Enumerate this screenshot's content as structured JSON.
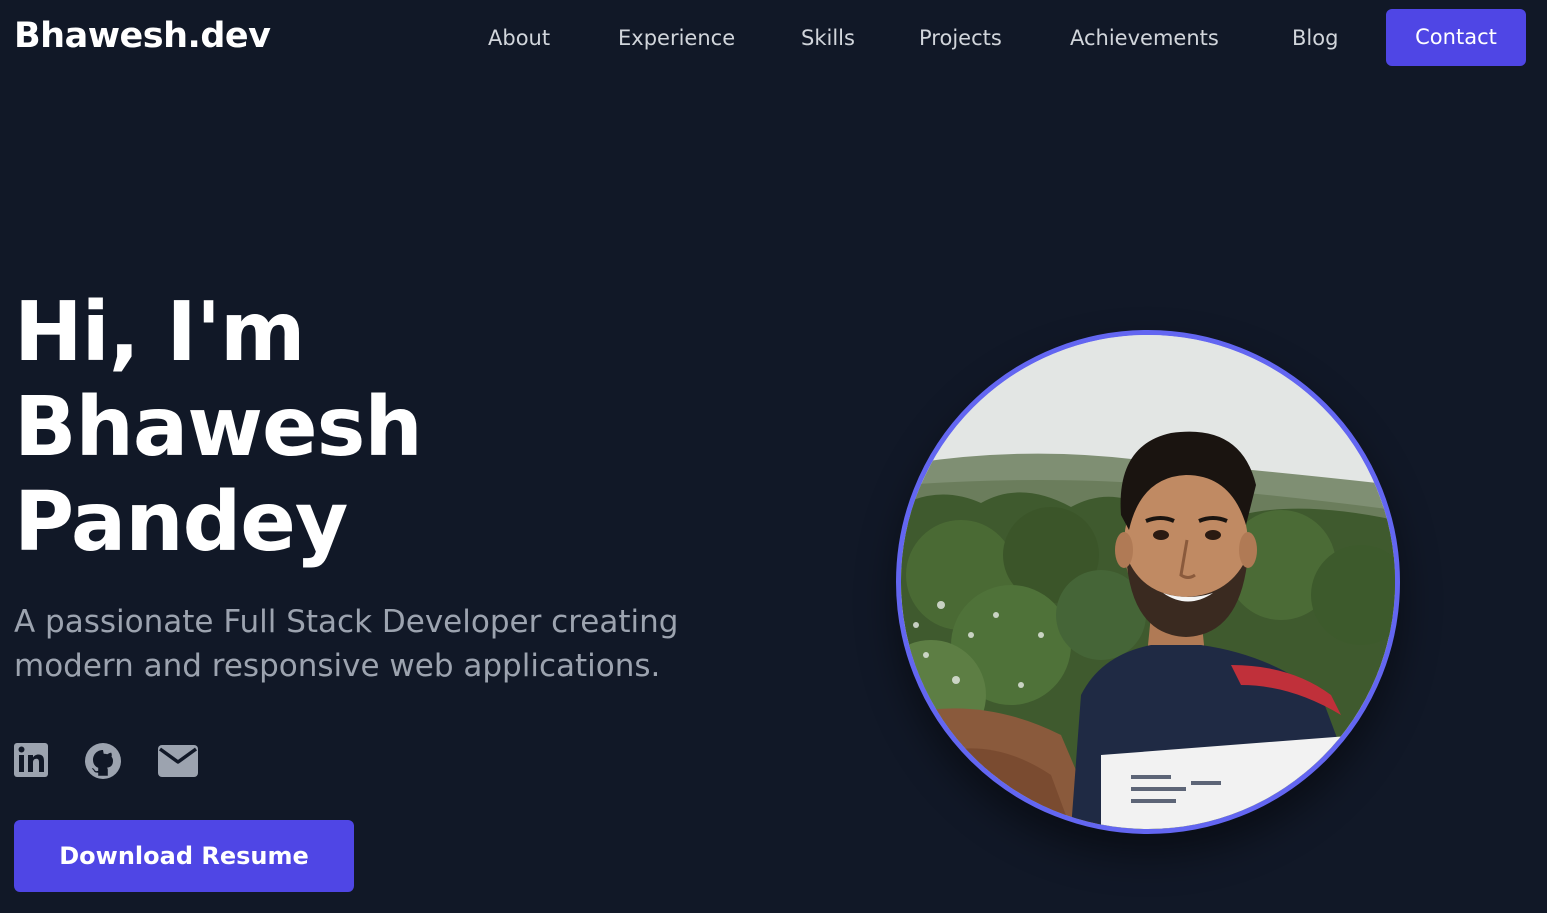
{
  "brand": {
    "logo": "Bhawesh.dev"
  },
  "nav": {
    "items": [
      {
        "label": "About"
      },
      {
        "label": "Experience"
      },
      {
        "label": "Skills"
      },
      {
        "label": "Projects"
      },
      {
        "label": "Achievements"
      },
      {
        "label": "Blog"
      }
    ],
    "contact_label": "Contact"
  },
  "hero": {
    "title_lines": [
      "Hi, I'm",
      "Bhawesh",
      "Pandey"
    ],
    "subtitle_lines": [
      "A passionate Full Stack Developer creating",
      "modern and responsive web applications."
    ],
    "resume_label": "Download Resume"
  },
  "social": {
    "icons": [
      "linkedin-icon",
      "github-icon",
      "mail-icon"
    ]
  },
  "colors": {
    "background": "#111827",
    "accent": "#4f46e5",
    "avatar_ring": "#6366f1",
    "nav_text": "#d1d5db",
    "subtitle_text": "#9ca3af",
    "icon_gray": "#9ca3af"
  }
}
